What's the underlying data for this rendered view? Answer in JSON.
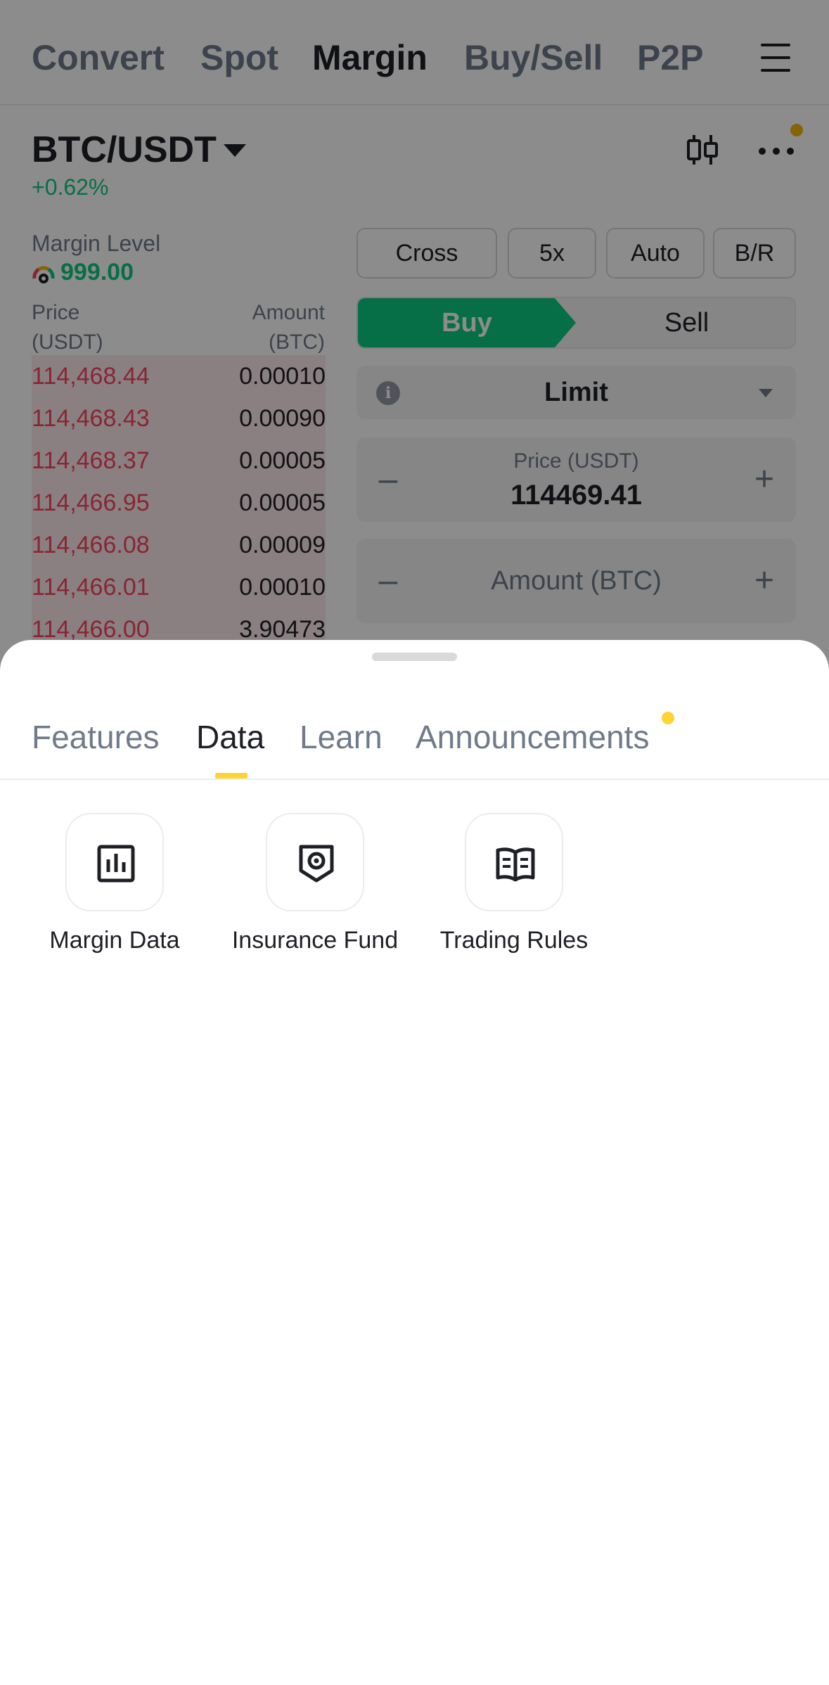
{
  "nav": {
    "tabs": [
      {
        "label": "Convert"
      },
      {
        "label": "Spot"
      },
      {
        "label": "Margin",
        "active": true
      },
      {
        "label": "Buy/Sell"
      },
      {
        "label": "P2P"
      }
    ],
    "menu_icon": "hamburger-menu-icon"
  },
  "pair": {
    "symbol": "BTC/USDT",
    "change": "+0.62%",
    "chart_icon": "candlestick-chart-icon",
    "more_icon": "more-dots-icon"
  },
  "margin_level": {
    "label": "Margin Level",
    "value": "999.00",
    "icon": "gauge-icon"
  },
  "orderbook": {
    "price_header": "Price\n(USDT)",
    "amount_header": "Amount\n(BTC)",
    "rows": [
      {
        "price": "114,468.44",
        "amount": "0.00010"
      },
      {
        "price": "114,468.43",
        "amount": "0.00090"
      },
      {
        "price": "114,468.37",
        "amount": "0.00005"
      },
      {
        "price": "114,466.95",
        "amount": "0.00005"
      },
      {
        "price": "114,466.08",
        "amount": "0.00009"
      },
      {
        "price": "114,466.01",
        "amount": "0.00010"
      },
      {
        "price": "114,466.00",
        "amount": "3.90473"
      }
    ]
  },
  "form": {
    "chips": [
      "Cross",
      "5x",
      "Auto",
      "B/R"
    ],
    "buy_label": "Buy",
    "sell_label": "Sell",
    "order_type": "Limit",
    "price_label": "Price (USDT)",
    "price_value": "114469.41",
    "amount_placeholder": "Amount (BTC)",
    "minus": "–",
    "plus": "+"
  },
  "sheet": {
    "tabs": [
      {
        "label": "Features"
      },
      {
        "label": "Data",
        "active": true
      },
      {
        "label": "Learn"
      },
      {
        "label": "Announcements",
        "has_dot": true
      }
    ],
    "tiles": [
      {
        "label": "Margin Data",
        "icon": "bar-chart-icon"
      },
      {
        "label": "Insurance Fund",
        "icon": "shield-icon"
      },
      {
        "label": "Trading Rules",
        "icon": "book-icon"
      }
    ],
    "accent_color": "#fcd535"
  },
  "colors": {
    "buy": "#0ecb81",
    "sell": "#f6465d",
    "brand": "#f0b90b"
  }
}
